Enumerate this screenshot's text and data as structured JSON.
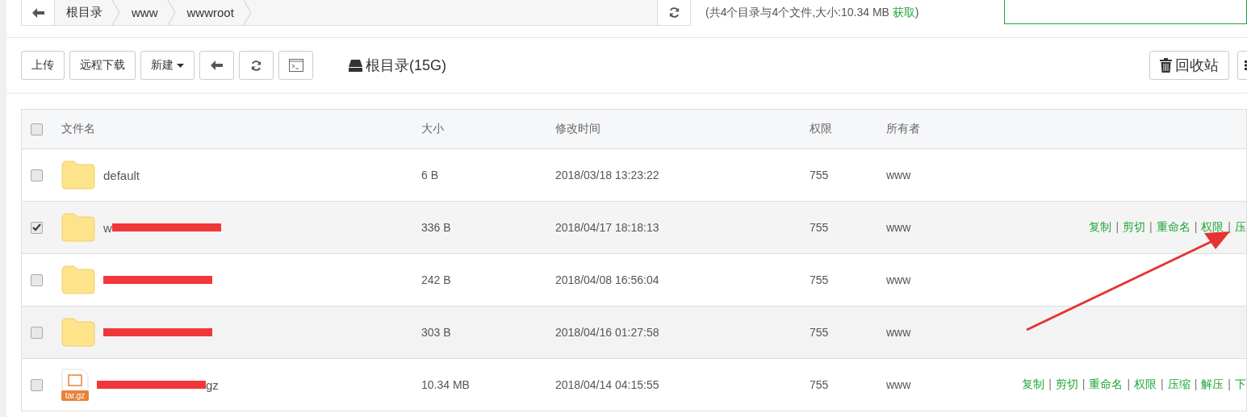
{
  "breadcrumb": {
    "items": [
      "根目录",
      "www",
      "wwwroot"
    ]
  },
  "summary": {
    "text": "(共4个目录与4个文件,大小:10.34 MB ",
    "link": "获取",
    "close": ")"
  },
  "toolbar": {
    "buttons": [
      {
        "kind": "text",
        "label": "上传"
      },
      {
        "kind": "text",
        "label": "远程下载"
      },
      {
        "kind": "dropdown",
        "label": "新建"
      },
      {
        "kind": "back"
      },
      {
        "kind": "refresh"
      },
      {
        "kind": "terminal"
      }
    ],
    "disk": "根目录(15G)",
    "recycle": "回收站"
  },
  "table": {
    "columns": [
      "文件名",
      "大小",
      "修改时间",
      "权限",
      "所有者"
    ],
    "header_checked": false,
    "rows": [
      {
        "kind": "folder",
        "name": "default",
        "redacted": false,
        "size": "6 B",
        "modified": "2018/03/18 13:23:22",
        "perm": "755",
        "owner": "www",
        "checked": false,
        "actions": []
      },
      {
        "kind": "folder",
        "name": "w",
        "redacted": true,
        "size": "336 B",
        "modified": "2018/04/17 18:18:13",
        "perm": "755",
        "owner": "www",
        "checked": true,
        "actions": [
          "复制",
          "剪切",
          "重命名",
          "权限",
          "压"
        ]
      },
      {
        "kind": "folder",
        "redacted": true,
        "size": "242 B",
        "modified": "2018/04/08 16:56:04",
        "perm": "755",
        "owner": "www",
        "checked": false,
        "actions": []
      },
      {
        "kind": "folder",
        "redacted": true,
        "size": "303 B",
        "modified": "2018/04/16 01:27:58",
        "perm": "755",
        "owner": "www",
        "checked": false,
        "actions": []
      },
      {
        "kind": "archive",
        "badge": "tar.gz",
        "suffix": "gz",
        "redacted": true,
        "size": "10.34 MB",
        "modified": "2018/04/14 04:15:55",
        "perm": "755",
        "owner": "www",
        "checked": false,
        "actions": [
          "复制",
          "剪切",
          "重命名",
          "权限",
          "压缩",
          "解压",
          "下"
        ]
      }
    ],
    "separator": "|"
  }
}
